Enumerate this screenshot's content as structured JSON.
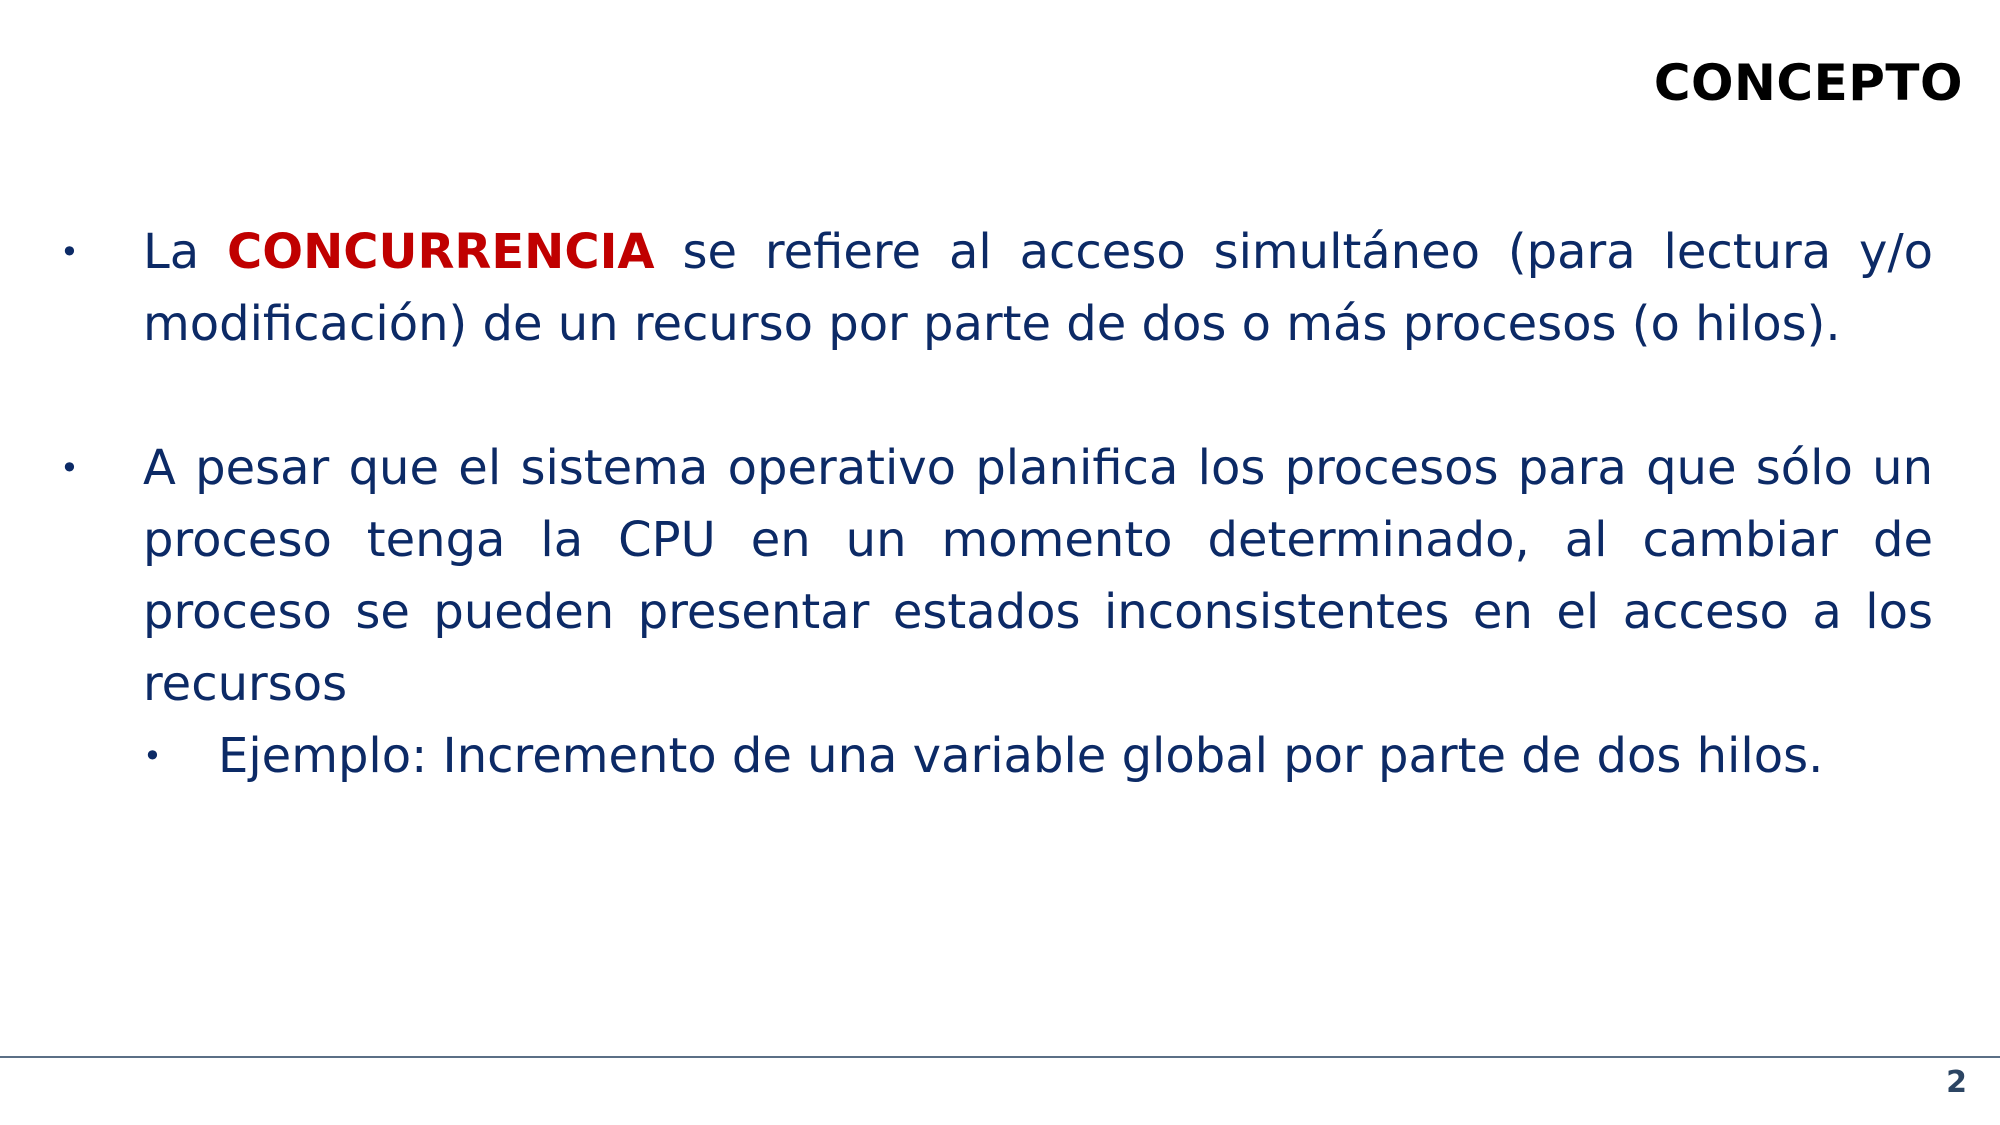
{
  "slide": {
    "title": "CONCEPTO",
    "page_number": "2",
    "bullet_symbol": "•",
    "bullets": [
      {
        "lead": "La ",
        "highlight": "CONCURRENCIA",
        "rest": " se refiere al acceso simultáneo (para lectura y/o modificación) de un recurso por parte de dos o más procesos (o hilos)."
      },
      {
        "text": "A pesar que el sistema operativo planifica los procesos para que sólo un proceso tenga la CPU en un momento determinado, al cambiar de proceso se pueden presentar estados inconsistentes en el acceso a los recursos",
        "sub_bullets": [
          "Ejemplo: Incremento de una variable global por parte de dos hilos."
        ]
      }
    ]
  },
  "colors": {
    "title": "#000000",
    "body_text": "#0c2a66",
    "highlight": "#c00000",
    "footer_line": "#5b6f86",
    "page_number": "#2c4563"
  }
}
